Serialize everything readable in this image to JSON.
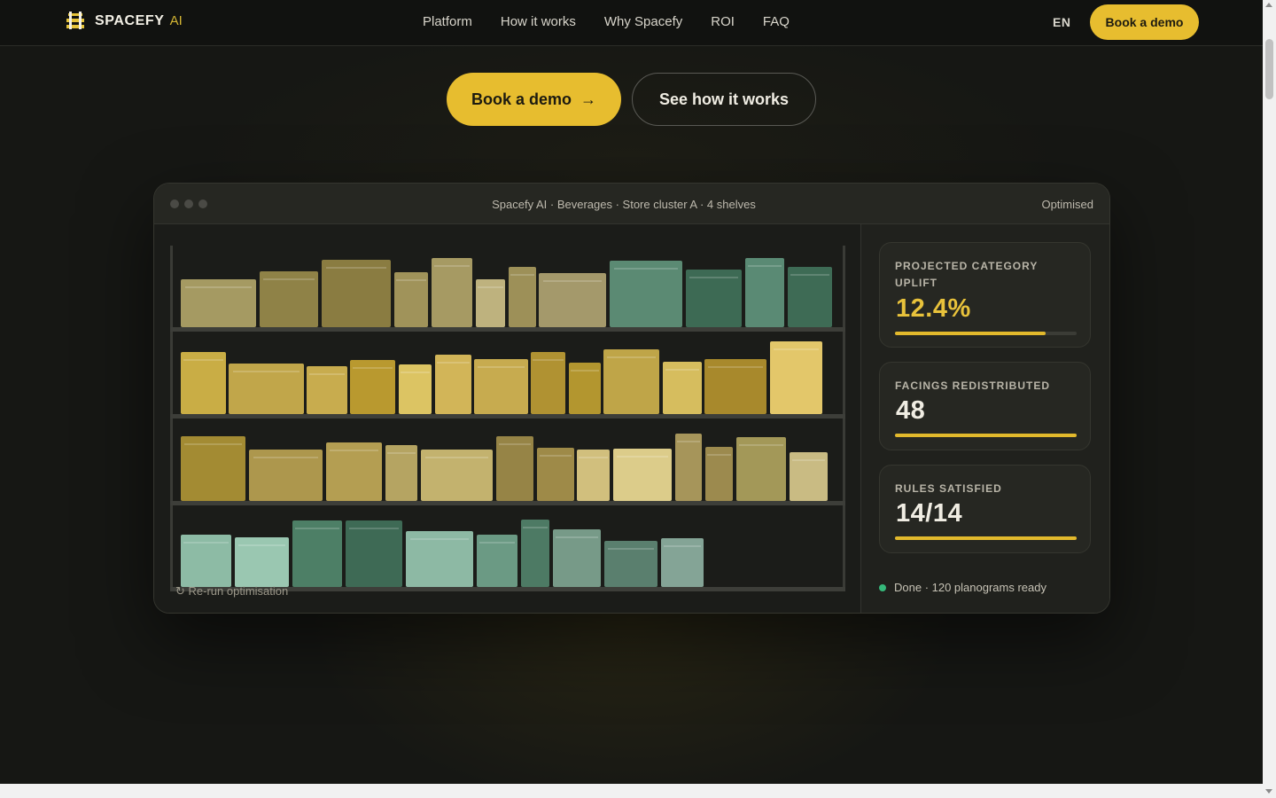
{
  "nav": {
    "brand": "SPACEFY",
    "brand_suffix": "AI",
    "links": [
      "Platform",
      "How it works",
      "Why Spacefy",
      "ROI",
      "FAQ"
    ],
    "language": "EN",
    "cta": "Book a demo"
  },
  "hero": {
    "primary_cta": "Book a demo",
    "primary_arrow": "→",
    "secondary_cta": "See how it works"
  },
  "window": {
    "title": "Spacefy AI · Beverages · Store cluster A · 4 shelves",
    "status": "Optimised",
    "rerun": "↻ Re-run optimisation",
    "metrics": [
      {
        "label": "PROJECTED CATEGORY UPLIFT",
        "value": "12.4%",
        "progress": 0.83,
        "accent": "#e8c23b"
      },
      {
        "label": "FACINGS REDISTRIBUTED",
        "value": "48",
        "progress": 1.0,
        "accent": "#f0ede3"
      },
      {
        "label": "RULES SATISFIED",
        "value": "14/14",
        "progress": 1.0,
        "accent": "#f0ede3"
      }
    ],
    "done_text": "Done · 120 planograms ready"
  },
  "colors": {
    "accent": "#e7bd2f",
    "background": "#161714",
    "status_green": "#35b87a"
  }
}
